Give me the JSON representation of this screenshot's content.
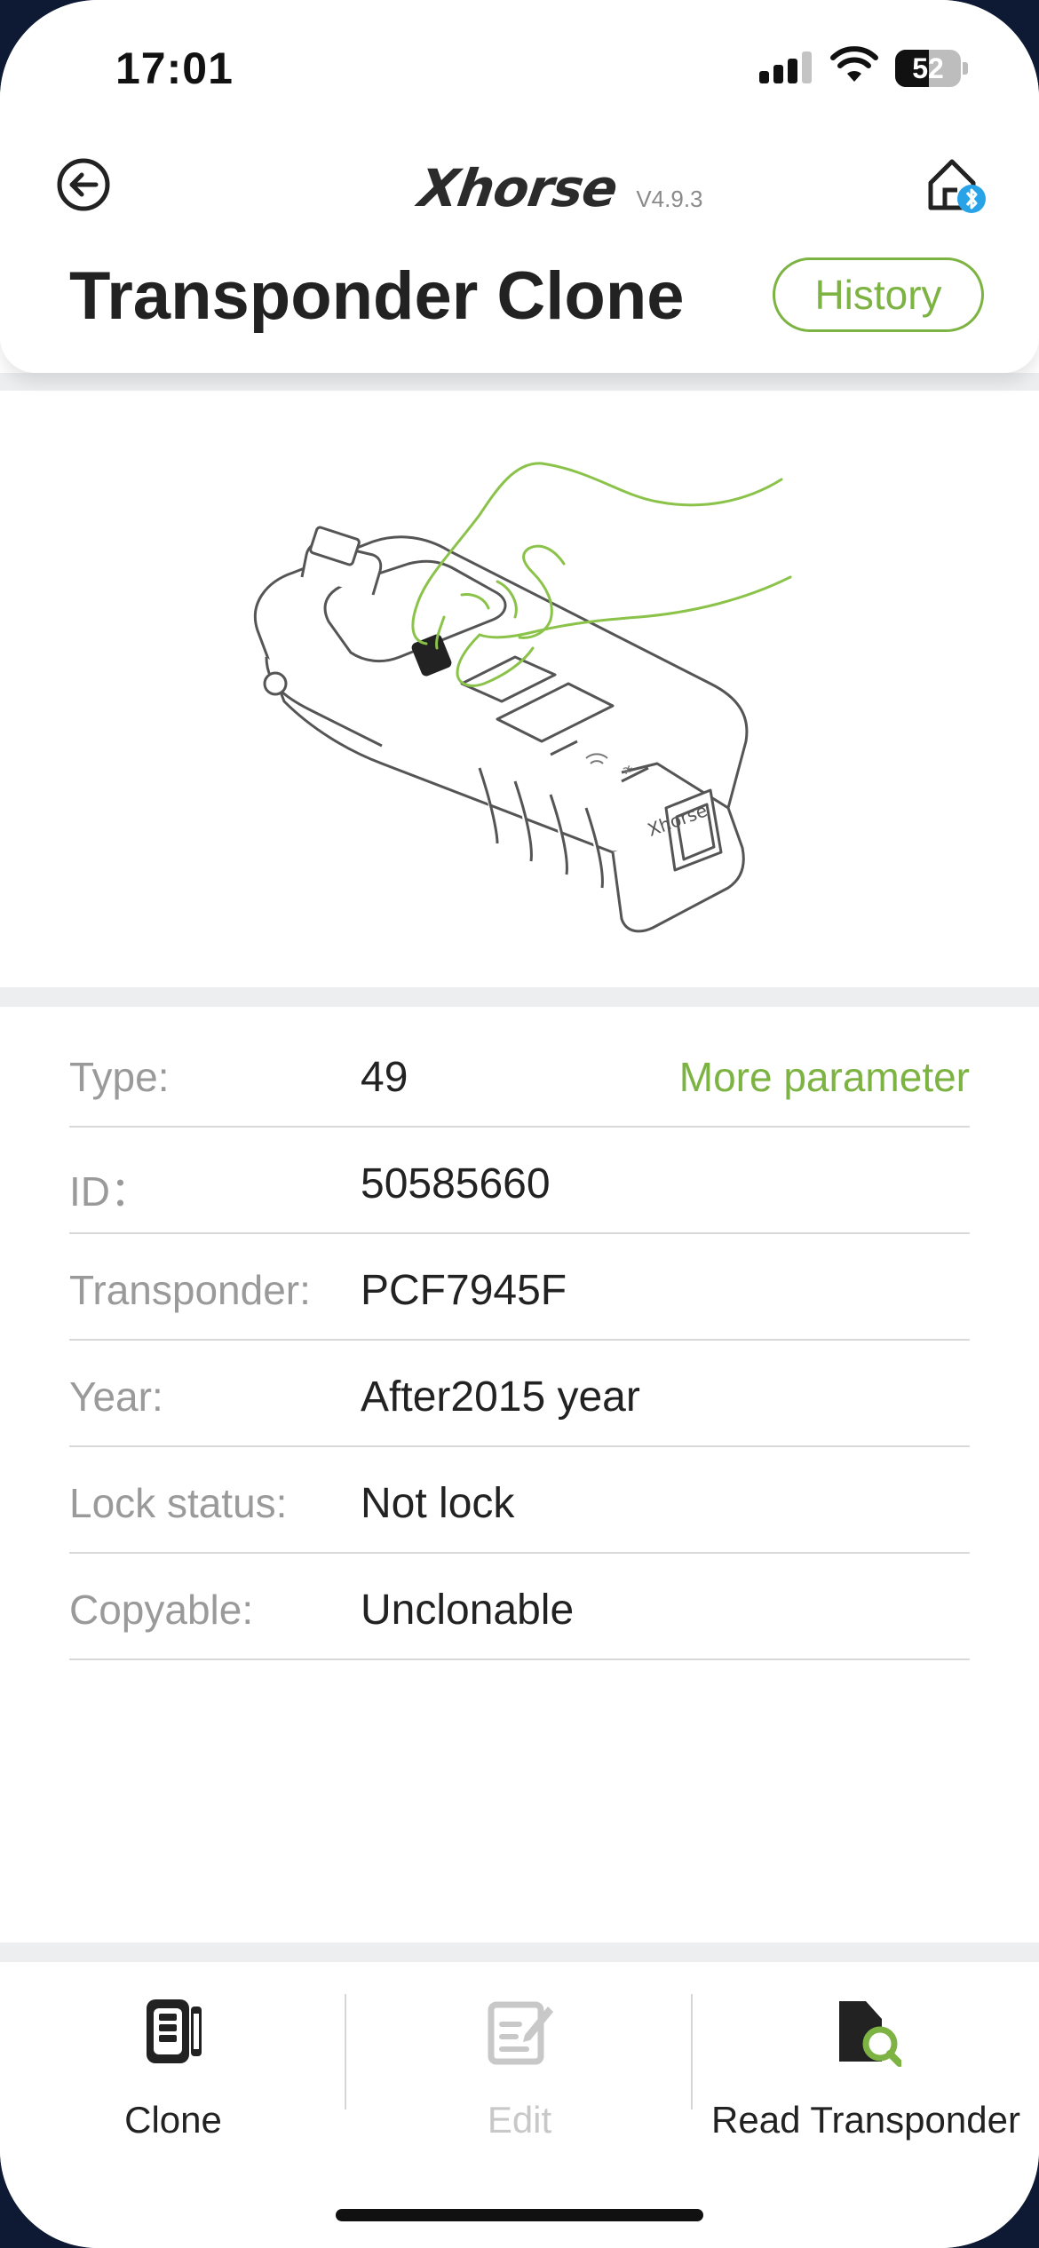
{
  "status_bar": {
    "time": "17:01",
    "battery": "52",
    "battery_level": 0.52,
    "signal_bars": 3
  },
  "header": {
    "brand": "Xhorse",
    "version": "V4.9.3",
    "title": "Transponder Clone",
    "history_label": "History",
    "back_icon": "back-arrow-circle-icon",
    "device_icon": "home-bluetooth-icon"
  },
  "colors": {
    "accent": "#7cb342",
    "text": "#222222",
    "label": "#9a9a9a",
    "divider": "#d9d9d9",
    "strip": "#eceef0"
  },
  "info": {
    "more_parameter": "More parameter",
    "rows": [
      {
        "label": "Type:",
        "value": "49"
      },
      {
        "label": "ID：",
        "value": "50585660"
      },
      {
        "label": "Transponder:",
        "value": "PCF7945F"
      },
      {
        "label": "Year:",
        "value": "After2015 year"
      },
      {
        "label": "Lock status:",
        "value": "Not lock"
      },
      {
        "label": "Copyable:",
        "value": "Unclonable"
      }
    ]
  },
  "tabs": [
    {
      "label": "Clone",
      "icon": "key-fob-icon",
      "enabled": true
    },
    {
      "label": "Edit",
      "icon": "edit-icon",
      "enabled": false
    },
    {
      "label": "Read Transponder",
      "icon": "read-transponder-icon",
      "enabled": true
    }
  ]
}
